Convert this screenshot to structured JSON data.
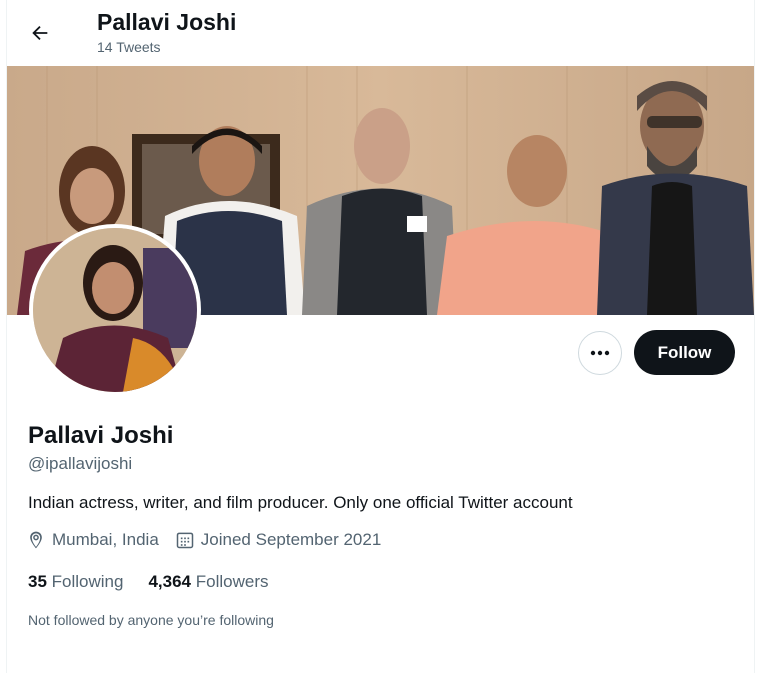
{
  "header": {
    "back_icon": "arrow-left-icon",
    "name": "Pallavi Joshi",
    "tweet_count": "14 Tweets"
  },
  "profile": {
    "name": "Pallavi Joshi",
    "handle": "@ipallavijoshi",
    "bio": "Indian actress, writer, and film producer. Only one official Twitter account",
    "location": "Mumbai, India",
    "location_icon": "location-pin-icon",
    "joined": "Joined September 2021",
    "joined_icon": "calendar-icon",
    "following_count": "35",
    "following_label": "Following",
    "followers_count": "4,364",
    "followers_label": "Followers",
    "not_followed_text": "Not followed by anyone you’re following"
  },
  "actions": {
    "more_icon": "more-dots-icon",
    "follow_label": "Follow"
  },
  "colors": {
    "text_primary": "#0f1419",
    "text_secondary": "#536471",
    "follow_bg": "#0f1419",
    "border": "#cfd9de"
  }
}
